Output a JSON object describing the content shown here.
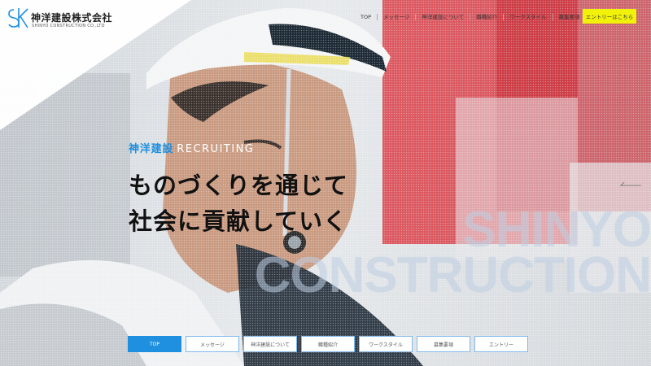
{
  "brand": {
    "mark": "SK",
    "name": "神洋建設株式会社",
    "subname": "SHINYO CONSTRUCTION CO.,LTD"
  },
  "top_nav": [
    {
      "label": "TOP"
    },
    {
      "label": "メッセージ"
    },
    {
      "label": "神洋建設について"
    },
    {
      "label": "職種紹介"
    },
    {
      "label": "ワークスタイル"
    },
    {
      "label": "募集要項"
    }
  ],
  "entry_button": {
    "label": "エントリーはこちら"
  },
  "hero": {
    "eyebrow_ja": "神洋建設",
    "eyebrow_en": "RECRUITING",
    "headline_line1": "ものづくりを通じて",
    "headline_line2": "社会に貢献していく",
    "watermark_line1": "SHINYO",
    "watermark_line2": "CONSTRUCTION"
  },
  "bottom_nav": [
    {
      "label": "TOP",
      "active": true
    },
    {
      "label": "メッセージ"
    },
    {
      "label": "神洋建設について"
    },
    {
      "label": "職種紹介"
    },
    {
      "label": "ワークスタイル"
    },
    {
      "label": "募集要項"
    },
    {
      "label": "エントリー"
    }
  ],
  "colors": {
    "accent": "#1f8fe0",
    "entry": "#f1f10a",
    "text": "#111111"
  }
}
